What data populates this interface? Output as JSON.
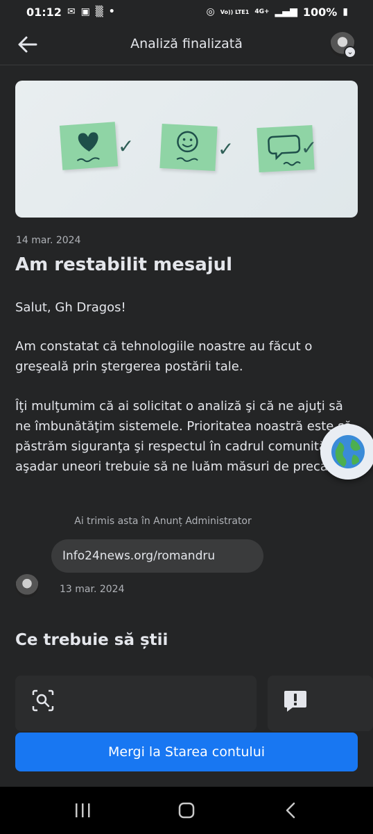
{
  "status_bar": {
    "time": "01:12",
    "battery": "100%",
    "network": "4G+",
    "lte": "Vo)) LTE1"
  },
  "app_bar": {
    "title": "Analiză finalizată"
  },
  "hero_image": {
    "icons": [
      "heart-note-icon",
      "smile-note-icon",
      "speech-note-icon"
    ],
    "note_color": "#8fd4a5"
  },
  "content": {
    "date": "14 mar. 2024",
    "headline": "Am restabilit mesajul",
    "greeting": "Salut, Gh Dragos!",
    "paragraph1": "Am constatat că tehnologiile noastre au făcut o greşeală prin ştergerea postării tale.",
    "paragraph2": "Îţi mulţumim că ai solicitat o analiză şi că ne ajuţi să ne îmbunătăţim sistemele. Prioritatea noastră este să păstrăm siguranţa şi respectul în cadrul comunităţii, aşadar uneori trebuie să ne luăm măsuri de precauţie."
  },
  "sent_post": {
    "label": "Ai trimis asta în Anunț Administrator",
    "link_text": "Info24news.org/romandru",
    "date": "13 mar. 2024"
  },
  "what_to_know": {
    "title": "Ce trebuie să știi",
    "cards": [
      {
        "icon": "search-icon"
      },
      {
        "icon": "alert-icon"
      }
    ]
  },
  "primary_button": {
    "label": "Mergi la Starea contului",
    "color": "#1877f2"
  },
  "floating_bubble": {
    "icon": "globe-icon"
  },
  "nav_bar": {
    "buttons": [
      "recents-icon",
      "home-icon",
      "back-icon"
    ]
  }
}
